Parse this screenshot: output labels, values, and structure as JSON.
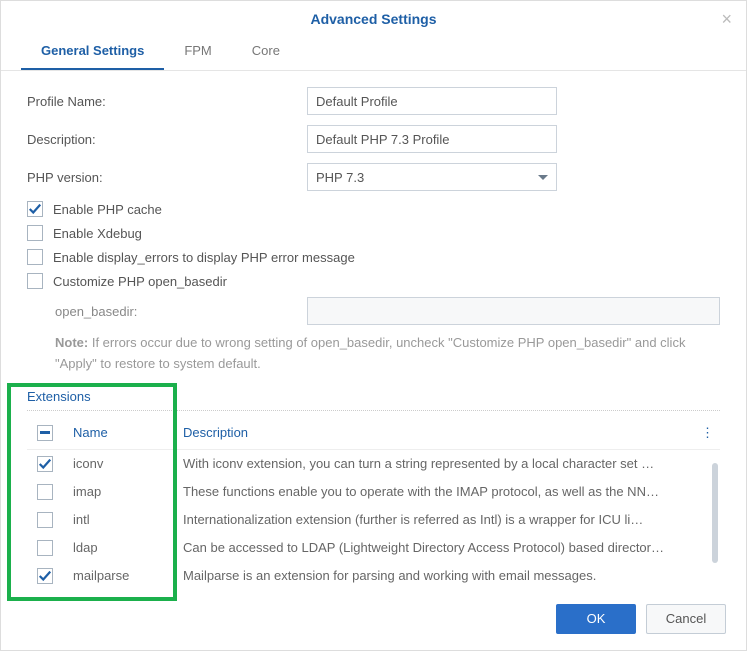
{
  "dialog": {
    "title": "Advanced Settings"
  },
  "tabs": {
    "general": "General Settings",
    "fpm": "FPM",
    "core": "Core"
  },
  "fields": {
    "profile_name_label": "Profile Name:",
    "profile_name_value": "Default Profile",
    "description_label": "Description:",
    "description_value": "Default PHP 7.3 Profile",
    "php_version_label": "PHP version:",
    "php_version_value": "PHP 7.3"
  },
  "checks": {
    "enable_cache": {
      "label": "Enable PHP cache",
      "checked": true
    },
    "enable_xdebug": {
      "label": "Enable Xdebug",
      "checked": false
    },
    "display_errors": {
      "label": "Enable display_errors to display PHP error message",
      "checked": false
    },
    "custom_basedir": {
      "label": "Customize PHP open_basedir",
      "checked": false
    }
  },
  "basedir": {
    "label": "open_basedir:"
  },
  "note": {
    "prefix": "Note:",
    "text": "If errors occur due to wrong setting of open_basedir, uncheck \"Customize PHP open_basedir\" and click \"Apply\" to restore to system default."
  },
  "extensions": {
    "title": "Extensions",
    "headers": {
      "name": "Name",
      "description": "Description"
    },
    "rows": [
      {
        "checked": true,
        "name": "iconv",
        "desc": "With iconv extension, you can turn a string represented by a local character set …"
      },
      {
        "checked": false,
        "name": "imap",
        "desc": "These functions enable you to operate with the IMAP protocol, as well as the NN…"
      },
      {
        "checked": false,
        "name": "intl",
        "desc": "Internationalization extension (further is referred as Intl) is a wrapper for ICU li…"
      },
      {
        "checked": false,
        "name": "ldap",
        "desc": "Can be accessed to LDAP (Lightweight Directory Access Protocol) based director…"
      },
      {
        "checked": true,
        "name": "mailparse",
        "desc": "Mailparse is an extension for parsing and working with email messages."
      }
    ]
  },
  "buttons": {
    "ok": "OK",
    "cancel": "Cancel"
  }
}
